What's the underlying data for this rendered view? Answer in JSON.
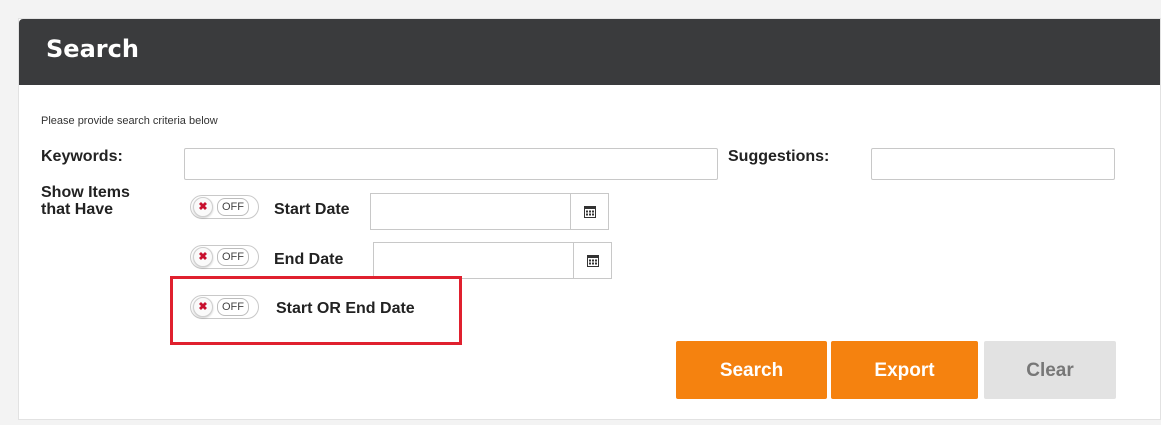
{
  "header": {
    "title": "Search"
  },
  "form": {
    "hint": "Please provide search criteria below",
    "keywords_label": "Keywords:",
    "keywords_value": "",
    "suggestions_label": "Suggestions:",
    "suggestions_value": "",
    "show_items_label": "Show Items that Have",
    "rows": [
      {
        "toggle_state": "OFF",
        "label": "Start Date",
        "date_value": ""
      },
      {
        "toggle_state": "OFF",
        "label": "End Date",
        "date_value": ""
      },
      {
        "toggle_state": "OFF",
        "label": "Start OR End Date"
      }
    ],
    "toggle_icon": "x-icon",
    "calendar_icon": "calendar-icon"
  },
  "actions": {
    "search_label": "Search",
    "export_label": "Export",
    "clear_label": "Clear"
  },
  "colors": {
    "header_bg": "#3a3b3d",
    "primary_button": "#f5820f",
    "disabled_button": "#e2e2e2",
    "highlight_border": "#e0202e",
    "toggle_x": "#c8102e"
  }
}
